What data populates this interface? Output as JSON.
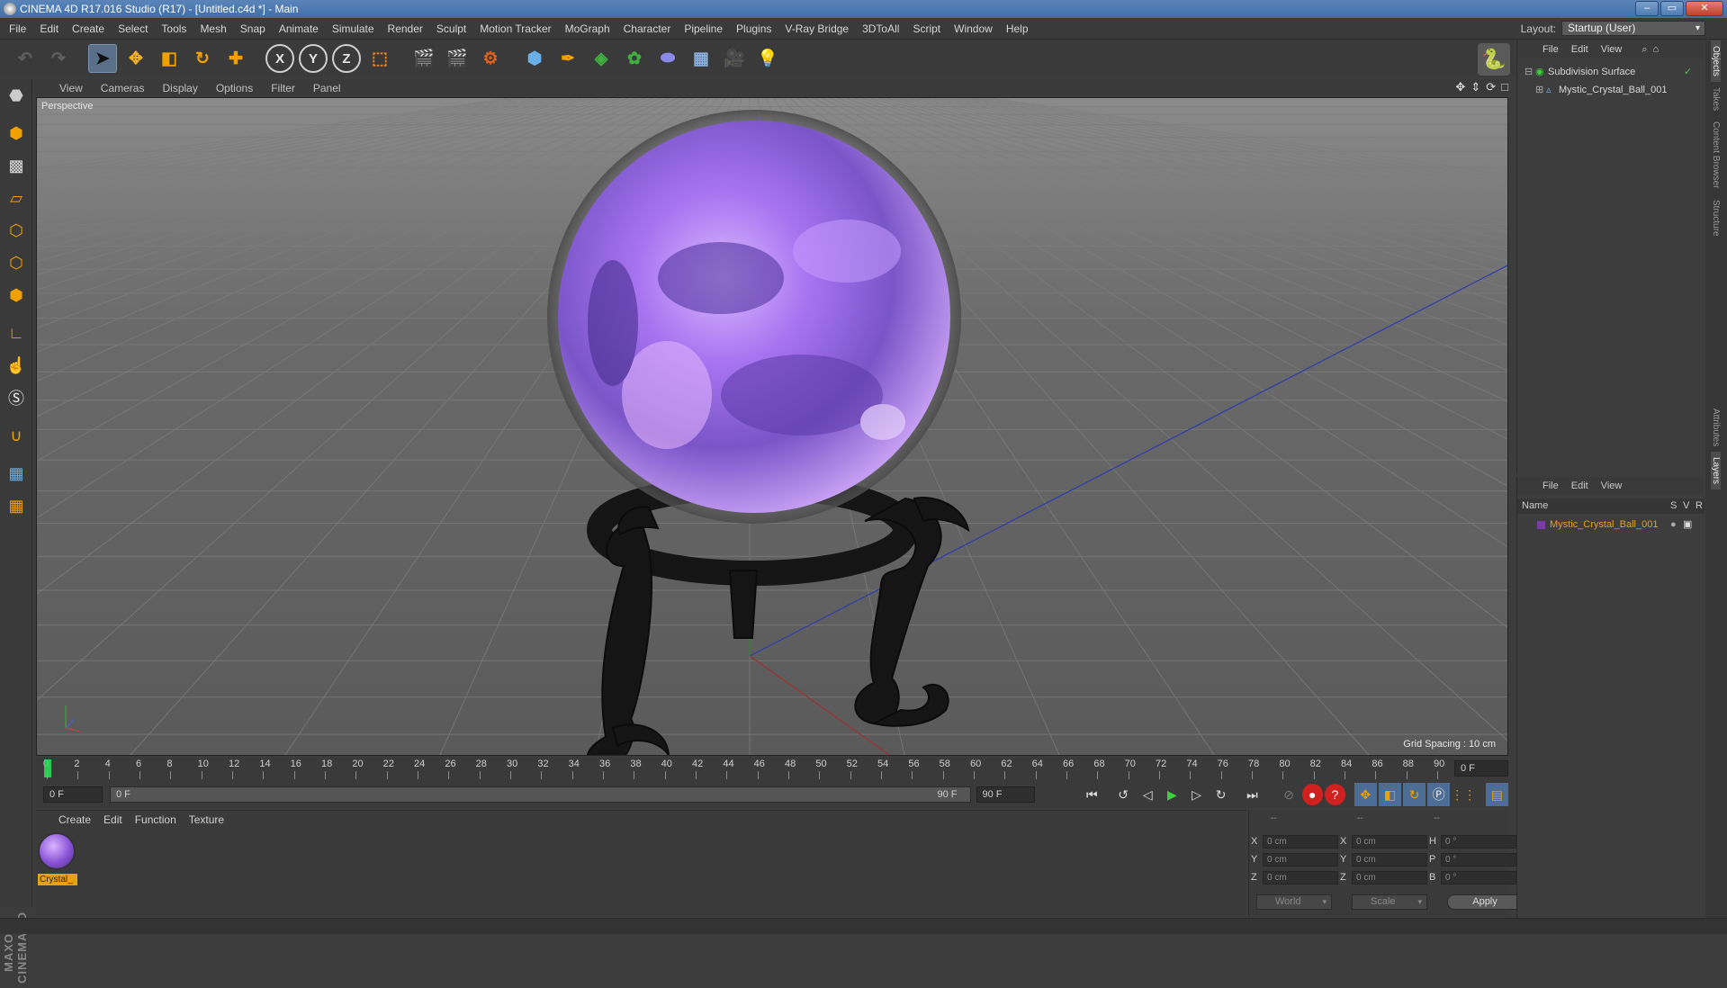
{
  "window": {
    "title": "CINEMA 4D R17.016 Studio (R17) - [Untitled.c4d *] - Main",
    "controls": [
      "–",
      "▭",
      "✕"
    ]
  },
  "menubar": {
    "items": [
      "File",
      "Edit",
      "Create",
      "Select",
      "Tools",
      "Mesh",
      "Snap",
      "Animate",
      "Simulate",
      "Render",
      "Sculpt",
      "Motion Tracker",
      "MoGraph",
      "Character",
      "Pipeline",
      "Plugins",
      "V-Ray Bridge",
      "3DToAll",
      "Script",
      "Window",
      "Help"
    ],
    "layout_label": "Layout:",
    "layout_value": "Startup (User)"
  },
  "toolbar": {
    "icons": [
      "undo-icon",
      "redo-icon",
      "select-cursor-icon",
      "move-icon",
      "scale-icon",
      "rotate-icon",
      "live-select-icon",
      "axis-x-icon",
      "axis-y-icon",
      "axis-z-icon",
      "coordinate-system-icon",
      "render-view-icon",
      "render-picture-viewer-icon",
      "render-settings-icon",
      "cube-icon",
      "pen-spline-icon",
      "subdivision-icon",
      "cloner-icon",
      "deformer-icon",
      "floor-icon",
      "camera-icon",
      "light-icon",
      "python-icon"
    ],
    "axis_labels": [
      "X",
      "Y",
      "Z"
    ]
  },
  "viewport": {
    "menu": [
      "View",
      "Cameras",
      "Display",
      "Options",
      "Filter",
      "Panel"
    ],
    "label": "Perspective",
    "grid_spacing": "Grid Spacing : 10 cm",
    "axis_labels": [
      "Y",
      "Z",
      "X"
    ]
  },
  "timeline": {
    "ticks": [
      "0",
      "2",
      "4",
      "6",
      "8",
      "10",
      "12",
      "14",
      "16",
      "18",
      "20",
      "22",
      "24",
      "26",
      "28",
      "30",
      "32",
      "34",
      "36",
      "38",
      "40",
      "42",
      "44",
      "46",
      "48",
      "50",
      "52",
      "54",
      "56",
      "58",
      "60",
      "62",
      "64",
      "66",
      "68",
      "70",
      "72",
      "74",
      "76",
      "78",
      "80",
      "82",
      "84",
      "86",
      "88",
      "90"
    ],
    "current_frame": "0 F"
  },
  "transport": {
    "start_field": "0 F",
    "slider_start": "0 F",
    "slider_end": "90 F",
    "end_field": "90 F"
  },
  "materials": {
    "menu": [
      "Create",
      "Edit",
      "Function",
      "Texture"
    ],
    "items": [
      {
        "label": "Crystal_"
      }
    ]
  },
  "coordinates": {
    "header": [
      "--",
      "--",
      "--"
    ],
    "rows": [
      {
        "l1": "X",
        "v1": "0 cm",
        "l2": "X",
        "v2": "0 cm",
        "l3": "H",
        "v3": "0 °"
      },
      {
        "l1": "Y",
        "v1": "0 cm",
        "l2": "Y",
        "v2": "0 cm",
        "l3": "P",
        "v3": "0 °"
      },
      {
        "l1": "Z",
        "v1": "0 cm",
        "l2": "Z",
        "v2": "0 cm",
        "l3": "B",
        "v3": "0 °"
      }
    ],
    "mode1": "World",
    "mode2": "Scale",
    "apply": "Apply"
  },
  "object_manager": {
    "menu": [
      "File",
      "Edit",
      "View"
    ],
    "objects": [
      {
        "name": "Subdivision Surface",
        "color": "#6fd16f"
      },
      {
        "name": "Mystic_Crystal_Ball_001",
        "color": "#c8c8c8"
      }
    ]
  },
  "layer_manager": {
    "menu": [
      "File",
      "Edit",
      "View"
    ],
    "columns": {
      "name": "Name",
      "s": "S",
      "v": "V",
      "r": "R"
    },
    "layers": [
      {
        "name": "Mystic_Crystal_Ball_001",
        "color": "#e2a21a"
      }
    ]
  },
  "right_tabs": [
    "Objects",
    "Takes",
    "Content Browser",
    "Structure",
    "Attributes",
    "Layers"
  ],
  "brand": "MAXON CINEMA 4D",
  "accent_colors": {
    "selection": "#5a6f8a",
    "material_label": "#e7a214",
    "crystal": "#9d6ce0"
  }
}
